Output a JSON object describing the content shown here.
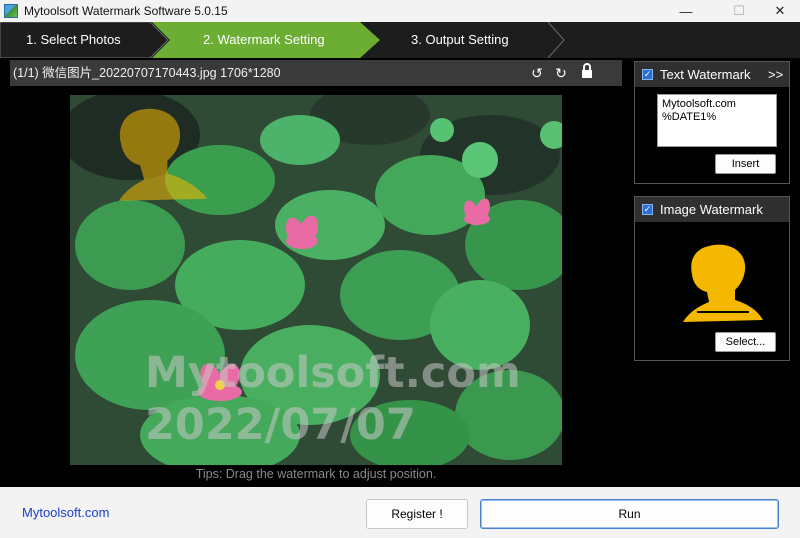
{
  "window": {
    "title": "Mytoolsoft Watermark Software 5.0.15",
    "minimize_glyph": "—",
    "maximize_glyph": "☐",
    "close_glyph": "✕"
  },
  "steps": [
    {
      "label": "1. Select Photos",
      "active": false
    },
    {
      "label": "2. Watermark Setting",
      "active": true
    },
    {
      "label": "3. Output Setting",
      "active": false
    }
  ],
  "colors": {
    "active_step": "#6cae34",
    "step_bg": "#1d1d1d",
    "watermark_icon": "#f5b800",
    "link": "#1a3fc7"
  },
  "preview": {
    "file_label": "(1/1) 微信图片_20220707170443.jpg 1706*1280",
    "rotate_left_icon": "rotate-left-icon",
    "rotate_right_icon": "rotate-right-icon",
    "lock_icon": "lock-icon",
    "watermark_line1": "Mytoolsoft.com",
    "watermark_line2": "2022/07/07",
    "tips": "Tips: Drag the watermark to adjust position."
  },
  "text_watermark": {
    "title": "Text Watermark",
    "checked": true,
    "expand_label": ">>",
    "content": "Mytoolsoft.com\n%DATE1%",
    "insert_label": "Insert"
  },
  "image_watermark": {
    "title": "Image Watermark",
    "checked": true,
    "select_label": "Select..."
  },
  "footer": {
    "site_link": "Mytoolsoft.com",
    "register_label": "Register !",
    "run_label": "Run"
  }
}
